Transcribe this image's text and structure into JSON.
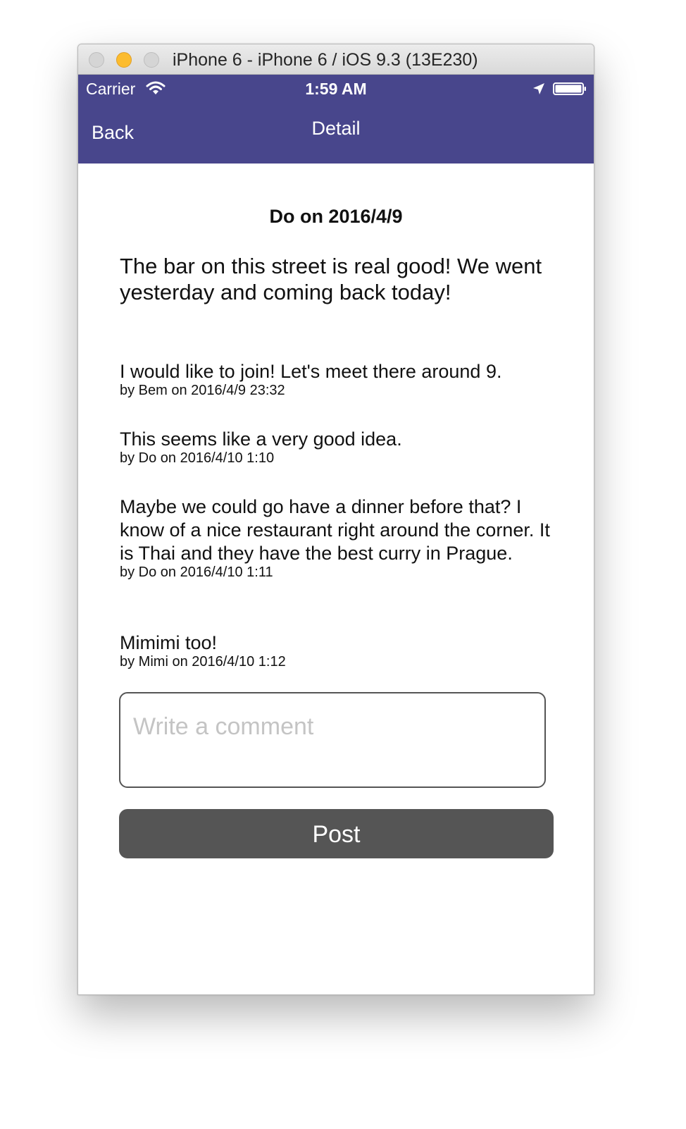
{
  "window": {
    "title": "iPhone 6 - iPhone 6 / iOS 9.3 (13E230)"
  },
  "status_bar": {
    "carrier": "Carrier",
    "time": "1:59 AM",
    "icons": [
      "wifi-icon",
      "location-arrow-icon",
      "battery-icon"
    ]
  },
  "nav": {
    "back_label": "Back",
    "title": "Detail"
  },
  "post": {
    "header": "Do on 2016/4/9",
    "body": "The bar on this street is real good! We went yesterday and coming back today!"
  },
  "comments": [
    {
      "text": "I would like to join! Let's meet there around 9.",
      "meta": "by Bem on 2016/4/9 23:32"
    },
    {
      "text": "This seems like a very good idea.",
      "meta": "by Do on 2016/4/10 1:10"
    },
    {
      "text": "Maybe we could go have a dinner before that? I know of a nice restaurant right around the corner. It is Thai and they have the best curry in Prague.",
      "meta": "by Do on 2016/4/10 1:11"
    },
    {
      "text": "Mimimi too!",
      "meta": "by Mimi on 2016/4/10 1:12"
    }
  ],
  "comment_form": {
    "value": "",
    "placeholder": "Write a comment",
    "submit_label": "Post"
  },
  "colors": {
    "nav_background": "#48468c",
    "button_background": "#555555",
    "placeholder": "#c4c4c4"
  }
}
